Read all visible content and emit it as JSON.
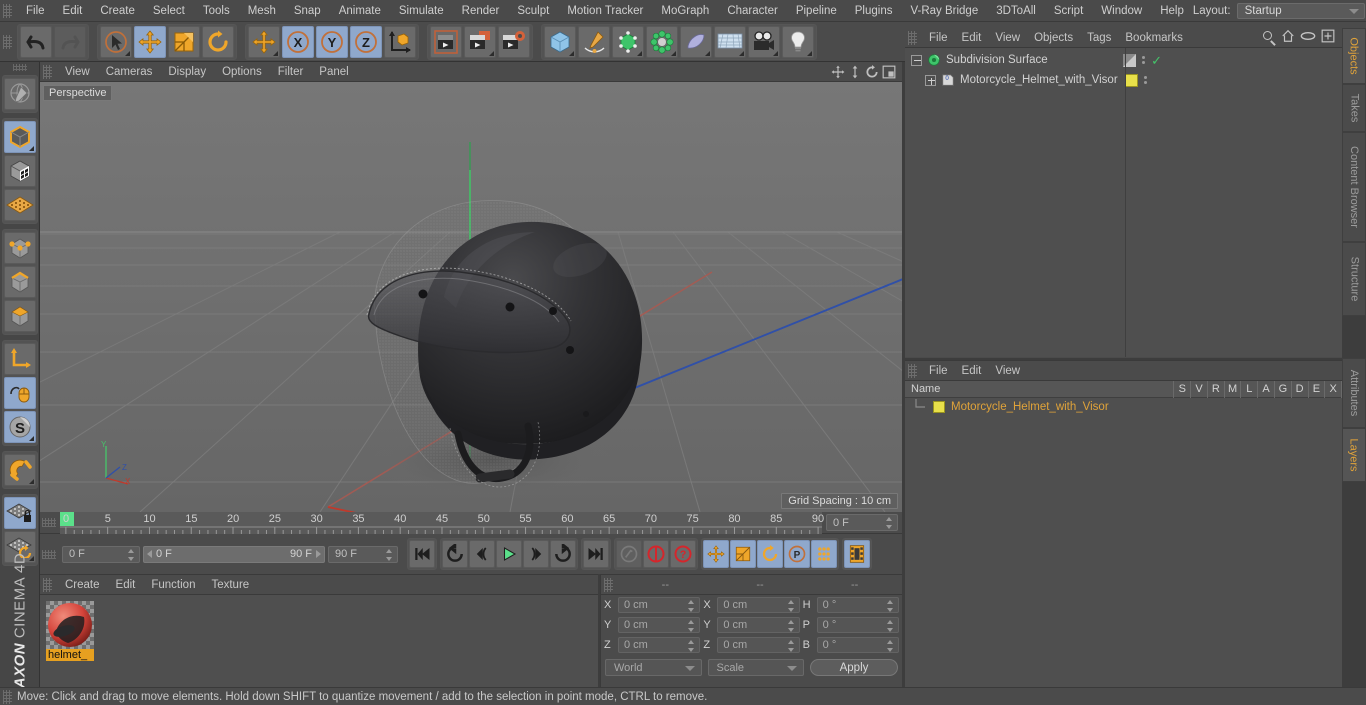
{
  "app": {
    "brand_maxon": "MAXON",
    "brand_product": "CINEMA 4D"
  },
  "menubar": {
    "items": [
      "File",
      "Edit",
      "Create",
      "Select",
      "Tools",
      "Mesh",
      "Snap",
      "Animate",
      "Simulate",
      "Render",
      "Sculpt",
      "Motion Tracker",
      "MoGraph",
      "Character",
      "Pipeline",
      "Plugins",
      "V-Ray Bridge",
      "3DToAll",
      "Script",
      "Window",
      "Help"
    ],
    "layout_label": "Layout:",
    "layout_value": "Startup",
    "search_icon": "magnifier-icon"
  },
  "toolbar": {
    "groups": [
      {
        "name": "undo-redo",
        "buttons": [
          {
            "icon": "undo-icon",
            "label": "Undo",
            "selected": false
          },
          {
            "icon": "redo-icon",
            "label": "Redo",
            "selected": false
          }
        ]
      },
      {
        "name": "transform-tools",
        "buttons": [
          {
            "icon": "select-live-icon",
            "label": "Live Selection",
            "selected": false
          },
          {
            "icon": "move-icon",
            "label": "Move",
            "selected": true
          },
          {
            "icon": "scale-icon",
            "label": "Scale",
            "selected": false
          },
          {
            "icon": "rotate-icon",
            "label": "Rotate",
            "selected": false
          }
        ]
      },
      {
        "name": "axis-locks",
        "buttons": [
          {
            "icon": "move-axis-icon",
            "label": "Move Axis",
            "selected": false
          },
          {
            "icon": "x-axis-icon",
            "label": "X",
            "selected": true
          },
          {
            "icon": "y-axis-icon",
            "label": "Y",
            "selected": true
          },
          {
            "icon": "z-axis-icon",
            "label": "Z",
            "selected": true
          },
          {
            "icon": "world-object-axis-icon",
            "label": "World/Object",
            "selected": false
          }
        ]
      },
      {
        "name": "render-tools",
        "buttons": [
          {
            "icon": "render-view-icon",
            "label": "Render View",
            "selected": false
          },
          {
            "icon": "render-region-icon",
            "label": "Render to Picture Viewer",
            "selected": false
          },
          {
            "icon": "render-settings-icon",
            "label": "Edit Render Settings",
            "selected": false
          }
        ]
      },
      {
        "name": "create-tools",
        "buttons": [
          {
            "icon": "cube-primitive-icon",
            "label": "Add Cube Object",
            "selected": false
          },
          {
            "icon": "spline-pen-icon",
            "label": "Add Spline",
            "selected": false
          },
          {
            "icon": "generator-icon",
            "label": "Add Generator",
            "selected": false
          },
          {
            "icon": "deformer-icon",
            "label": "Add Deformer",
            "selected": false
          },
          {
            "icon": "scene-object-icon",
            "label": "Add Scene Object",
            "selected": false
          },
          {
            "icon": "floor-icon",
            "label": "Add Environment",
            "selected": false
          },
          {
            "icon": "camera-icon",
            "label": "Add Camera",
            "selected": false
          },
          {
            "icon": "light-icon",
            "label": "Add Light",
            "selected": false
          }
        ]
      }
    ]
  },
  "left_toolbar": {
    "groups": [
      {
        "name": "make-editable",
        "buttons": [
          {
            "icon": "make-editable-icon",
            "label": "Make Editable",
            "selected": false
          }
        ]
      },
      {
        "name": "modes",
        "buttons": [
          {
            "icon": "model-mode-icon",
            "label": "Model Mode",
            "selected": true
          },
          {
            "icon": "texture-mode-icon",
            "label": "Texture Mode",
            "selected": false
          },
          {
            "icon": "workplane-mode-icon",
            "label": "Workplane Mode",
            "selected": false
          }
        ]
      },
      {
        "name": "components",
        "buttons": [
          {
            "icon": "points-mode-icon",
            "label": "Points",
            "selected": false
          },
          {
            "icon": "edges-mode-icon",
            "label": "Edges",
            "selected": false
          },
          {
            "icon": "polygons-mode-icon",
            "label": "Polygons",
            "selected": false
          }
        ]
      },
      {
        "name": "axis-modeling",
        "buttons": [
          {
            "icon": "object-axis-icon",
            "label": "Enable Axis",
            "selected": false
          },
          {
            "icon": "viewport-solo-icon",
            "label": "Viewport Solo",
            "selected": true
          },
          {
            "icon": "enable-snap-icon",
            "label": "Enable Snapping",
            "selected": true
          }
        ]
      },
      {
        "name": "magnet",
        "buttons": [
          {
            "icon": "magnet-icon",
            "label": "Magnet",
            "selected": false
          }
        ]
      },
      {
        "name": "workplane",
        "buttons": [
          {
            "icon": "lock-workplane-icon",
            "label": "Lock Workplane",
            "selected": true
          },
          {
            "icon": "planar-workplane-icon",
            "label": "Planar Workplane",
            "selected": false
          }
        ]
      }
    ]
  },
  "viewport": {
    "menu": [
      "View",
      "Cameras",
      "Display",
      "Options",
      "Filter",
      "Panel"
    ],
    "label": "Perspective",
    "grid_spacing": "Grid Spacing : 10 cm",
    "axis_labels": {
      "x": "X",
      "y": "Y",
      "z": "Z"
    },
    "corner_icons": [
      "pan-icon",
      "dolly-icon",
      "rotate-view-icon",
      "maximize-view-icon"
    ]
  },
  "timeline": {
    "ticks": [
      "0",
      "5",
      "10",
      "15",
      "20",
      "25",
      "30",
      "35",
      "40",
      "45",
      "50",
      "55",
      "60",
      "65",
      "70",
      "75",
      "80",
      "85",
      "90"
    ],
    "current_frame": "0 F",
    "current_frame_right": "0 F",
    "range_start": "0 F",
    "range_end": "90 F",
    "max_frame": "90 F",
    "buttons": [
      {
        "icon": "go-to-start-icon",
        "label": "Go To Start",
        "selected": false
      },
      {
        "icon": "prev-key-icon",
        "label": "Go To Previous Key",
        "selected": false
      },
      {
        "icon": "step-back-icon",
        "label": "Go To Previous Frame",
        "selected": false
      },
      {
        "icon": "play-icon",
        "label": "Play Forwards",
        "selected": false
      },
      {
        "icon": "step-forward-icon",
        "label": "Go To Next Frame",
        "selected": false
      },
      {
        "icon": "next-key-icon",
        "label": "Go To Next Key",
        "selected": false
      },
      {
        "icon": "go-to-end-icon",
        "label": "Go To End",
        "selected": false
      },
      {
        "icon": "record-active-icon",
        "label": "Record Active Objects",
        "selected": false
      },
      {
        "icon": "autokey-icon",
        "label": "Autokeying",
        "selected": false
      },
      {
        "icon": "keyframe-selection-icon",
        "label": "Keyframe Selection",
        "selected": false
      },
      {
        "icon": "key-position-icon",
        "label": "Position",
        "selected": true
      },
      {
        "icon": "key-scale-icon",
        "label": "Scale",
        "selected": true
      },
      {
        "icon": "key-rotation-icon",
        "label": "Rotation",
        "selected": true
      },
      {
        "icon": "key-param-icon",
        "label": "Parameter",
        "selected": true
      },
      {
        "icon": "key-pla-icon",
        "label": "Point Level Animation",
        "selected": true
      },
      {
        "icon": "timeline-icon",
        "label": "Timeline",
        "selected": true
      }
    ]
  },
  "material_manager": {
    "menu": [
      "Create",
      "Edit",
      "Function",
      "Texture"
    ],
    "materials": [
      {
        "name": "helmet_",
        "selected": true
      }
    ]
  },
  "coordinates": {
    "headers": [
      "--",
      "--",
      "--"
    ],
    "rows": [
      {
        "label1": "X",
        "value1": "0 cm",
        "label2": "X",
        "value2": "0 cm",
        "label3": "H",
        "value3": "0 °"
      },
      {
        "label1": "Y",
        "value1": "0 cm",
        "label2": "Y",
        "value2": "0 cm",
        "label3": "P",
        "value3": "0 °"
      },
      {
        "label1": "Z",
        "value1": "0 cm",
        "label2": "Z",
        "value2": "0 cm",
        "label3": "B",
        "value3": "0 °"
      }
    ],
    "coord_system": "World",
    "size_mode": "Scale",
    "apply_label": "Apply"
  },
  "object_manager": {
    "menu": [
      "File",
      "Edit",
      "View",
      "Objects",
      "Tags",
      "Bookmarks"
    ],
    "icons": [
      "search-icon",
      "home-icon",
      "ellipse-icon",
      "new-window-icon"
    ],
    "items": [
      {
        "name": "Subdivision Surface",
        "type": "generator",
        "indent": 0,
        "expanded": true,
        "tag_color": "#858585",
        "checked": true
      },
      {
        "name": "Motorcycle_Helmet_with_Visor",
        "type": "polygon-object",
        "indent": 1,
        "expanded": false,
        "tag_color": "#e8e04a",
        "checked": false
      }
    ]
  },
  "layer_manager": {
    "menu": [
      "File",
      "Edit",
      "View"
    ],
    "columns": [
      "Name",
      "S",
      "V",
      "R",
      "M",
      "L",
      "A",
      "G",
      "D",
      "E",
      "X"
    ],
    "rows": [
      {
        "name": "Motorcycle_Helmet_with_Visor",
        "color": "#e8e04a"
      }
    ]
  },
  "side_tabs": {
    "top": [
      {
        "label": "Objects",
        "active": true
      },
      {
        "label": "Takes",
        "active": false
      },
      {
        "label": "Content Browser",
        "active": false
      },
      {
        "label": "Structure",
        "active": false
      }
    ],
    "bottom": [
      {
        "label": "Attributes",
        "active": false
      },
      {
        "label": "Layers",
        "active": true
      }
    ]
  },
  "status_bar": {
    "text": "Move: Click and drag to move elements. Hold down SHIFT to quantize movement / add to the selection in point mode, CTRL to remove."
  },
  "colors": {
    "accent_orange": "#e8a33a",
    "selection_blue": "#8fa8cc",
    "panel_bg": "#4b4b4b",
    "viewport_bg": "#6e6e6e",
    "x_axis": "#c0392b",
    "y_axis": "#27ae60",
    "z_axis": "#2f4fb0"
  }
}
